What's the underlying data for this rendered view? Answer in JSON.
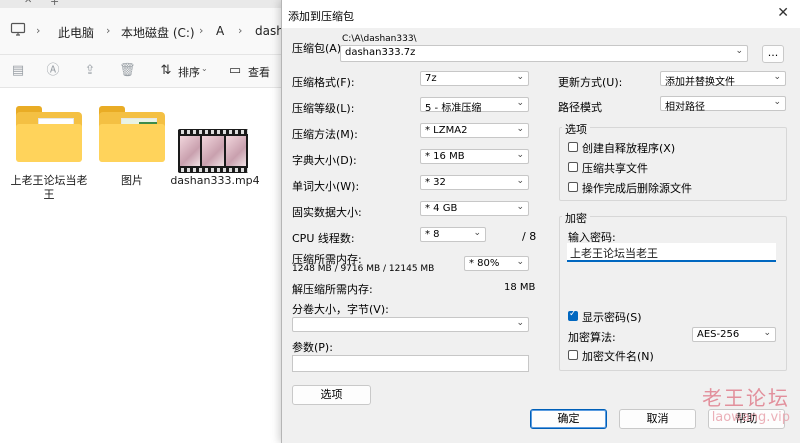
{
  "explorer": {
    "breadcrumb": [
      "此电脑",
      "本地磁盘 (C:)",
      "A",
      "dasha"
    ],
    "toolbar": {
      "sort_label": "排序",
      "view_label": "查看"
    },
    "files": [
      {
        "name": "上老王论坛当老王",
        "type": "folder"
      },
      {
        "name": "图片",
        "type": "folder"
      },
      {
        "name": "dashan333.mp4",
        "type": "video"
      }
    ]
  },
  "dialog": {
    "title": "添加到压缩包",
    "archive_label": "压缩包(A):",
    "archive_path": "C:\\A\\dashan333\\",
    "archive_name": "dashan333.7z",
    "browse_label": "...",
    "format": {
      "label": "压缩格式(F):",
      "value": "7z"
    },
    "level": {
      "label": "压缩等级(L):",
      "value": "5 - 标准压缩"
    },
    "method": {
      "label": "压缩方法(M):",
      "value": "* LZMA2"
    },
    "dict": {
      "label": "字典大小(D):",
      "value": "* 16 MB"
    },
    "word": {
      "label": "单词大小(W):",
      "value": "* 32"
    },
    "solid": {
      "label": "固实数据大小:",
      "value": "* 4 GB"
    },
    "cpu": {
      "label": "CPU 线程数:",
      "value": "* 8",
      "max": "/ 8"
    },
    "mem_comp": {
      "label": "压缩所需内存:",
      "detail": "1248 MB / 9716 MB / 12145 MB",
      "value": "* 80%"
    },
    "mem_decomp": {
      "label": "解压缩所需内存:",
      "value": "18 MB"
    },
    "split": {
      "label": "分卷大小，字节(V):",
      "value": ""
    },
    "params": {
      "label": "参数(P):",
      "value": ""
    },
    "options_button": "选项",
    "update": {
      "label": "更新方式(U):",
      "value": "添加并替换文件"
    },
    "path_mode": {
      "label": "路径模式",
      "value": "相对路径"
    },
    "options_group": {
      "title": "选项",
      "items": [
        {
          "label": "创建自释放程序(X)",
          "checked": false
        },
        {
          "label": "压缩共享文件",
          "checked": false
        },
        {
          "label": "操作完成后删除源文件",
          "checked": false
        }
      ]
    },
    "encryption": {
      "title": "加密",
      "password_label": "输入密码:",
      "password_value": "上老王论坛当老王",
      "show_password": {
        "label": "显示密码(S)",
        "checked": true
      },
      "method_label": "加密算法:",
      "method_value": "AES-256",
      "encrypt_names": {
        "label": "加密文件名(N)",
        "checked": false
      }
    },
    "buttons": {
      "ok": "确定",
      "cancel": "取消",
      "help": "帮助"
    }
  },
  "watermark": {
    "main": "老王论坛",
    "sub": "laowang.vip"
  }
}
